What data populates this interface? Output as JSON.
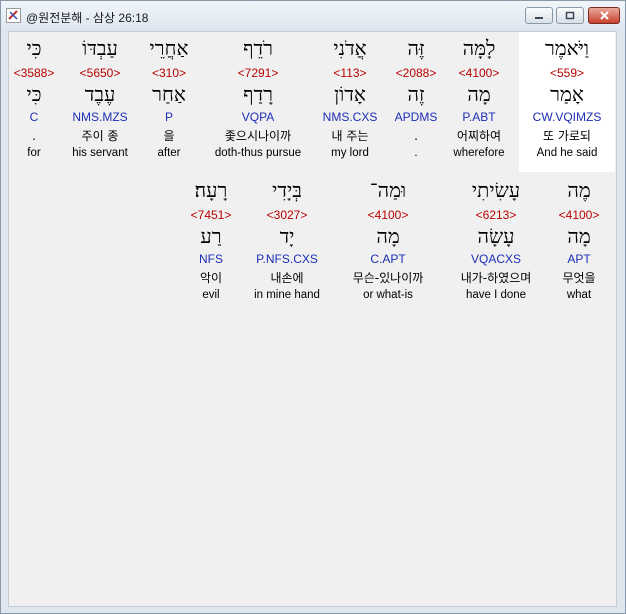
{
  "window": {
    "title": "@원전분해 - 삼상 26:18"
  },
  "rows": [
    [
      {
        "hebrew": "וַיֹּאמֶר",
        "strong": "<559>",
        "lemma": "אָמַר",
        "parse": "CW.VQIMZS",
        "korean": "또 가로되",
        "english": "And he said",
        "selected": true
      },
      {
        "hebrew": "לָמָּה",
        "strong": "<4100>",
        "lemma": "מָה",
        "parse": "P.ABT",
        "korean": "어찌하여",
        "english": "wherefore"
      },
      {
        "hebrew": "זֶּה",
        "strong": "<2088>",
        "lemma": "זֶה",
        "parse": "APDMS",
        "korean": ".",
        "english": "."
      },
      {
        "hebrew": "אֲדֹנִי",
        "strong": "<113>",
        "lemma": "אָדוֹן",
        "parse": "NMS.CXS",
        "korean": "내 주는",
        "english": "my lord"
      },
      {
        "hebrew": "רֹדֵף",
        "strong": "<7291>",
        "lemma": "רָדַף",
        "parse": "VQPA",
        "korean": "좇으시나이까",
        "english": "doth-thus pursue"
      },
      {
        "hebrew": "אַחֲרֵי",
        "strong": "<310>",
        "lemma": "אַחַר",
        "parse": "P",
        "korean": "을",
        "english": "after"
      },
      {
        "hebrew": "עַבְדּוֹ",
        "strong": "<5650>",
        "lemma": "עֶבֶד",
        "parse": "NMS.MZS",
        "korean": "주이 종",
        "english": "his servant"
      },
      {
        "hebrew": "כִּי",
        "strong": "<3588>",
        "lemma": "כִּי",
        "parse": "C",
        "korean": ".",
        "english": "for"
      }
    ],
    [
      {
        "hebrew": "מֶה",
        "strong": "<4100>",
        "lemma": "מָה",
        "parse": "APT",
        "korean": "무엇을",
        "english": "what"
      },
      {
        "hebrew": "עָשִׂיתִי",
        "strong": "<6213>",
        "lemma": "עָשָׂה",
        "parse": "VQACXS",
        "korean": "내가-하였으며",
        "english": "have I done"
      },
      {
        "hebrew": "וּמַה־",
        "strong": "<4100>",
        "lemma": "מָה",
        "parse": "C.APT",
        "korean": "무슨-있나이까",
        "english": "or what-is"
      },
      {
        "hebrew": "בְּיָדִי",
        "strong": "<3027>",
        "lemma": "יָד",
        "parse": "P.NFS.CXS",
        "korean": "내손에",
        "english": "in mine hand"
      },
      {
        "hebrew": "רָעָה׃",
        "strong": "<7451>",
        "lemma": "רַע",
        "parse": "NFS",
        "korean": "악이",
        "english": "evil"
      }
    ]
  ]
}
